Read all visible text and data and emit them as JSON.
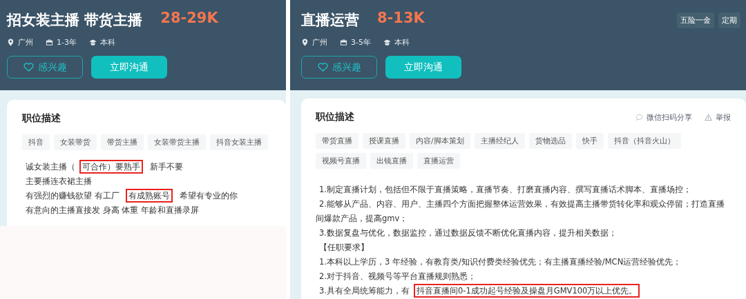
{
  "panels": [
    {
      "title": "招女装主播 带货主播",
      "salary": "28-29K",
      "meta": [
        {
          "kind": "location",
          "text": "广州"
        },
        {
          "kind": "experience",
          "text": "1-3年"
        },
        {
          "kind": "degree",
          "text": "本科"
        }
      ],
      "buttons": [
        {
          "kind": "interest",
          "label": "感兴趣"
        },
        {
          "kind": "chat",
          "label": "立即沟通"
        }
      ],
      "section": {
        "heading": "职位描述",
        "tags": [
          "抖音",
          "女装带货",
          "带货主播",
          "女装带货主播",
          "抖音女装主播"
        ],
        "lines": [
          {
            "segments": [
              {
                "text": "诚女装主播（",
                "highlighted": false
              },
              {
                "text": "可合作）要熟手",
                "highlighted": true
              },
              {
                "text": " 新手不要",
                "highlighted": false
              }
            ]
          },
          {
            "segments": [
              {
                "text": "主要播连衣裙主播",
                "highlighted": false
              }
            ]
          },
          {
            "segments": [
              {
                "text": "有强烈的赚钱欲望 有工厂 ",
                "highlighted": false
              },
              {
                "text": "有成熟账号",
                "highlighted": true
              },
              {
                "text": " 希望有专业的你",
                "highlighted": false
              }
            ]
          },
          {
            "segments": [
              {
                "text": "有意向的主播直接发 身高 体重 年龄和直播录屏",
                "highlighted": false
              }
            ]
          }
        ]
      }
    },
    {
      "title": "直播运营",
      "salary": "8-13K",
      "benefits": [
        "五险一金",
        "定期"
      ],
      "meta": [
        {
          "kind": "location",
          "text": "广州"
        },
        {
          "kind": "experience",
          "text": "3-5年"
        },
        {
          "kind": "degree",
          "text": "本科"
        }
      ],
      "buttons": [
        {
          "kind": "interest",
          "label": "感兴趣"
        },
        {
          "kind": "chat",
          "label": "立即沟通"
        }
      ],
      "section": {
        "heading": "职位描述",
        "actions": [
          {
            "kind": "share",
            "label": "微信扫码分享"
          },
          {
            "kind": "report",
            "label": "举报"
          }
        ],
        "tags": [
          "带货直播",
          "授课直播",
          "内容/脚本策划",
          "主播经纪人",
          "货物选品",
          "快手",
          "抖音（抖音火山）",
          "视频号直播",
          "出镜直播",
          "直播运营"
        ],
        "lines": [
          {
            "segments": [
              {
                "text": "1.制定直播计划，包括但不限于直播策略，直播节奏、打磨直播内容、撰写直播话术脚本、直播场控；",
                "highlighted": false
              }
            ]
          },
          {
            "segments": [
              {
                "text": "2.能够从产品、内容、用户、主播四个方面把握整体运营效果，有效提高主播带货转化率和观众停留；打造直播间爆款产品，提高gmv；",
                "highlighted": false
              }
            ]
          },
          {
            "segments": [
              {
                "text": "3.数据复盘与优化，数据监控，通过数据反馈不断优化直播内容，提升相关数据；",
                "highlighted": false
              }
            ]
          },
          {
            "segments": [
              {
                "text": "【任职要求】",
                "highlighted": false
              }
            ]
          },
          {
            "segments": [
              {
                "text": "1.本科以上学历，3 年经验，有教育类/知识付费类经验优先；有主播直播经验/MCN运营经验优先；",
                "highlighted": false
              }
            ]
          },
          {
            "segments": [
              {
                "text": "2.对于抖音、视频号等平台直播规则熟悉；",
                "highlighted": false
              }
            ]
          },
          {
            "segments": [
              {
                "text": "3.具有全局统筹能力，有",
                "highlighted": false
              },
              {
                "text": "抖音直播间0-1成功起号经验及操盘月GMV100万以上优先。",
                "highlighted": true
              }
            ]
          }
        ]
      }
    }
  ]
}
